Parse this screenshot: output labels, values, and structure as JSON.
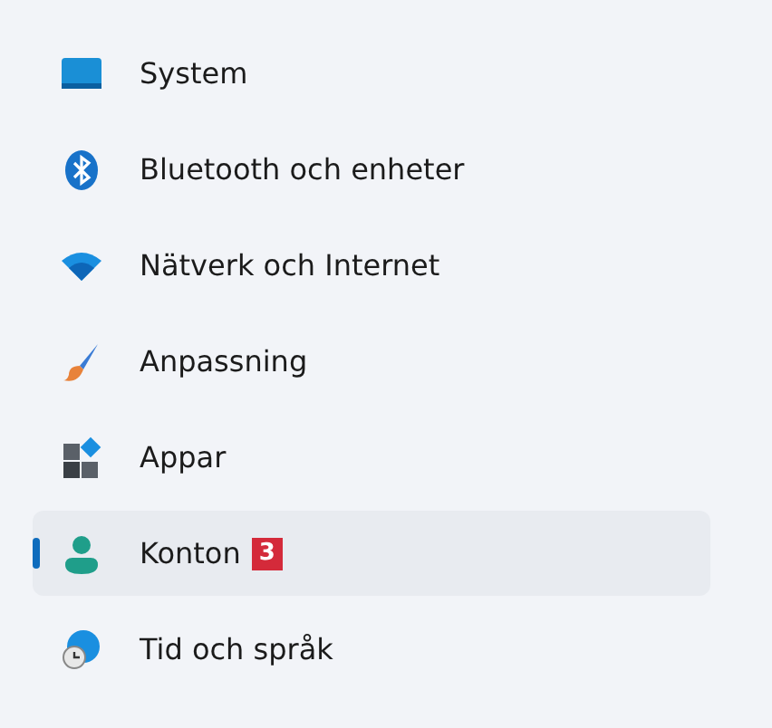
{
  "sidebar": {
    "items": [
      {
        "label": "System",
        "selected": false
      },
      {
        "label": "Bluetooth och enheter",
        "selected": false
      },
      {
        "label": "Nätverk och Internet",
        "selected": false
      },
      {
        "label": "Anpassning",
        "selected": false
      },
      {
        "label": "Appar",
        "selected": false
      },
      {
        "label": "Konton",
        "selected": true,
        "badge": "3"
      },
      {
        "label": "Tid och språk",
        "selected": false
      }
    ]
  }
}
